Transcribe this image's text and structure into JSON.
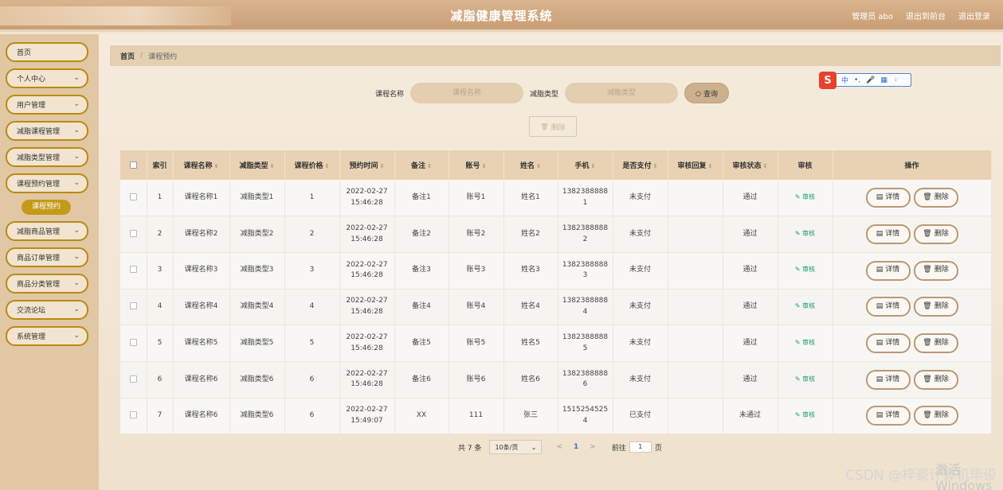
{
  "header": {
    "title": "减脂健康管理系统",
    "user": "管理员 abo",
    "back": "退出到前台",
    "logout": "退出登录"
  },
  "sidebar": {
    "items": [
      {
        "label": "首页",
        "chevron": false
      },
      {
        "label": "个人中心",
        "chevron": true
      },
      {
        "label": "用户管理",
        "chevron": true
      },
      {
        "label": "减脂课程管理",
        "chevron": true
      },
      {
        "label": "减脂类型管理",
        "chevron": true
      },
      {
        "label": "课程预约管理",
        "chevron": true
      },
      {
        "label": "课程预约",
        "sub": true
      },
      {
        "label": "减脂商品管理",
        "chevron": true
      },
      {
        "label": "商品订单管理",
        "chevron": true
      },
      {
        "label": "商品分类管理",
        "chevron": true
      },
      {
        "label": "交流论坛",
        "chevron": true
      },
      {
        "label": "系统管理",
        "chevron": true
      }
    ]
  },
  "breadcrumb": {
    "home": "首页",
    "sep": "/",
    "current": "课程预约"
  },
  "search": {
    "course_label": "课程名称",
    "course_placeholder": "课程名称",
    "type_label": "减脂类型",
    "type_placeholder": "减脂类型",
    "query": "查询",
    "query_icon": "○"
  },
  "delete_label": "删除",
  "delete_icon": "🗑",
  "ime": {
    "badge": "S",
    "items": [
      "中",
      "•,",
      "🎤",
      "▦",
      "⁘"
    ]
  },
  "table": {
    "headers": [
      "索引",
      "课程名称",
      "减脂类型",
      "课程价格",
      "预约时间",
      "备注",
      "账号",
      "姓名",
      "手机",
      "是否支付",
      "审核回复",
      "审核状态",
      "审核",
      "操作"
    ],
    "rows": [
      {
        "idx": "1",
        "course": "课程名称1",
        "type": "减脂类型1",
        "price": "1",
        "date": "2022-02-27",
        "time": "15:46:28",
        "note": "备注1",
        "account": "账号1",
        "name": "姓名1",
        "phone1": "1382388888",
        "phone2": "1",
        "paid": "未支付",
        "reply": "",
        "status": "通过"
      },
      {
        "idx": "2",
        "course": "课程名称2",
        "type": "减脂类型2",
        "price": "2",
        "date": "2022-02-27",
        "time": "15:46:28",
        "note": "备注2",
        "account": "账号2",
        "name": "姓名2",
        "phone1": "1382388888",
        "phone2": "2",
        "paid": "未支付",
        "reply": "",
        "status": "通过"
      },
      {
        "idx": "3",
        "course": "课程名称3",
        "type": "减脂类型3",
        "price": "3",
        "date": "2022-02-27",
        "time": "15:46:28",
        "note": "备注3",
        "account": "账号3",
        "name": "姓名3",
        "phone1": "1382388888",
        "phone2": "3",
        "paid": "未支付",
        "reply": "",
        "status": "通过"
      },
      {
        "idx": "4",
        "course": "课程名称4",
        "type": "减脂类型4",
        "price": "4",
        "date": "2022-02-27",
        "time": "15:46:28",
        "note": "备注4",
        "account": "账号4",
        "name": "姓名4",
        "phone1": "1382388888",
        "phone2": "4",
        "paid": "未支付",
        "reply": "",
        "status": "通过"
      },
      {
        "idx": "5",
        "course": "课程名称5",
        "type": "减脂类型5",
        "price": "5",
        "date": "2022-02-27",
        "time": "15:46:28",
        "note": "备注5",
        "account": "账号5",
        "name": "姓名5",
        "phone1": "1382388888",
        "phone2": "5",
        "paid": "未支付",
        "reply": "",
        "status": "通过"
      },
      {
        "idx": "6",
        "course": "课程名称6",
        "type": "减脂类型6",
        "price": "6",
        "date": "2022-02-27",
        "time": "15:46:28",
        "note": "备注6",
        "account": "账号6",
        "name": "姓名6",
        "phone1": "1382388888",
        "phone2": "6",
        "paid": "未支付",
        "reply": "",
        "status": "通过"
      },
      {
        "idx": "7",
        "course": "课程名称6",
        "type": "减脂类型6",
        "price": "6",
        "date": "2022-02-27",
        "time": "15:49:07",
        "note": "XX",
        "account": "111",
        "name": "张三",
        "phone1": "1515254525",
        "phone2": "4",
        "paid": "已支付",
        "reply": "",
        "status": "未通过"
      }
    ],
    "audit_label": "审核",
    "detail_label": "详情",
    "remove_label": "删除"
  },
  "pager": {
    "total": "共 7 条",
    "size": "10条/页",
    "prev": "<",
    "page": "1",
    "next": ">",
    "goto_pre": "前往",
    "goto_val": "1",
    "goto_post": "页"
  },
  "watermark": "CSDN @梓豪计算机毕设",
  "watermark2": "激活 Windows"
}
